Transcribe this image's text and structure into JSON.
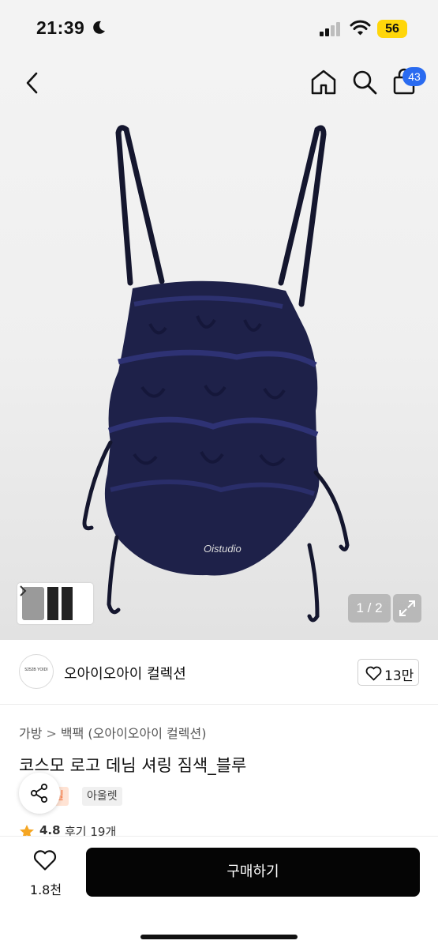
{
  "status_bar": {
    "time": "21:39",
    "battery": "56",
    "icons": [
      "moon-icon",
      "signal-icon",
      "wifi-icon"
    ]
  },
  "header": {
    "icons": [
      "back-icon",
      "home-icon",
      "search-icon",
      "cart-icon"
    ],
    "cart_count": "43"
  },
  "gallery": {
    "counter": "1 / 2",
    "current_index": 1,
    "total": 2,
    "image_logo_text": "Oistudio",
    "icons": [
      "chevron-right-icon",
      "expand-icon"
    ]
  },
  "store": {
    "name": "오아이오아이 컬렉션",
    "logo_text": "5252B YOIDI",
    "likes": "13만"
  },
  "product": {
    "breadcrumb": [
      "가방",
      "백팩 (오아이오아이 컬렉션)"
    ],
    "title": "코스모 로고 데님 셔링 짐색_블루",
    "tags": [
      "세일",
      "아울렛"
    ],
    "sale_tag_visible": "일",
    "rating": "4.8",
    "review_label": "후기 19개"
  },
  "bottom_bar": {
    "wish_count": "1.8천",
    "buy_label": "구매하기"
  },
  "colors": {
    "accent_blue": "#2a6bf0",
    "battery_yellow": "#ffd60a",
    "sale_orange": "#ff6a2a",
    "star_gold": "#f5a623",
    "buy_button": "#050505",
    "bag_navy": "#1c1f45"
  }
}
